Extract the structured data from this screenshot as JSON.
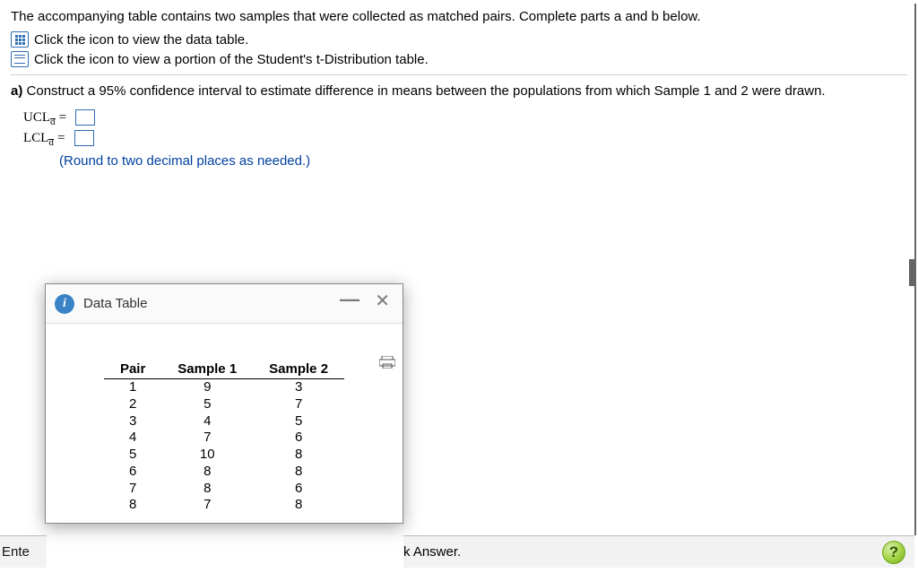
{
  "intro": "The accompanying table contains two samples that were collected as matched pairs. Complete parts a and b below.",
  "links": {
    "data_table": "Click the icon to view the data table.",
    "t_table": "Click the icon to view a portion of the Student's t-Distribution table."
  },
  "part_a": {
    "label_prefix": "a) ",
    "text": "Construct a 95% confidence interval to estimate difference in means between the populations from which Sample 1 and 2 were drawn.",
    "ucl_label": "UCL",
    "lcl_label": "LCL",
    "sub": "d̄",
    "equals": "=",
    "rounding": "(Round to two decimal places as needed.)"
  },
  "modal": {
    "title": "Data Table",
    "info_glyph": "i",
    "minimize": "—",
    "close": "✕",
    "headers": {
      "pair": "Pair",
      "s1": "Sample 1",
      "s2": "Sample 2"
    },
    "rows": [
      {
        "pair": "1",
        "s1": "9",
        "s2": "3"
      },
      {
        "pair": "2",
        "s1": "5",
        "s2": "7"
      },
      {
        "pair": "3",
        "s1": "4",
        "s2": "5"
      },
      {
        "pair": "4",
        "s1": "7",
        "s2": "6"
      },
      {
        "pair": "5",
        "s1": "10",
        "s2": "8"
      },
      {
        "pair": "6",
        "s1": "8",
        "s2": "8"
      },
      {
        "pair": "7",
        "s1": "8",
        "s2": "6"
      },
      {
        "pair": "8",
        "s1": "7",
        "s2": "8"
      }
    ]
  },
  "bottom": {
    "left_fragment": "Ente",
    "right_fragment": "k Answer.",
    "help": "?"
  }
}
